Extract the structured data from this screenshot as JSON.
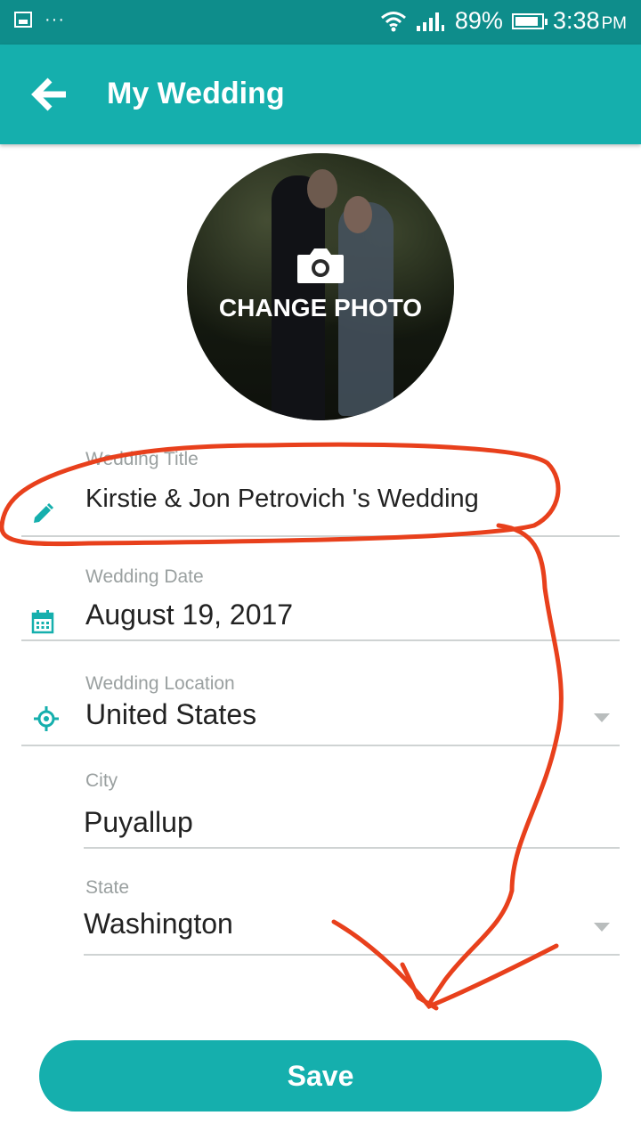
{
  "status_bar": {
    "dots": "···",
    "battery": "89%",
    "battery_level": 0.89,
    "time": "3:38",
    "time_suffix": "PM"
  },
  "app_bar": {
    "title": "My Wedding",
    "back_icon": "arrow-left-icon"
  },
  "photo": {
    "change_label": "CHANGE PHOTO",
    "icon": "camera-icon"
  },
  "form": {
    "title": {
      "label": "Wedding Title",
      "value": "Kirstie & Jon Petrovich 's Wedding",
      "icon": "pencil-icon"
    },
    "date": {
      "label": "Wedding Date",
      "value": "August 19, 2017",
      "icon": "calendar-icon"
    },
    "location": {
      "label": "Wedding Location",
      "value": "United States",
      "icon": "location-target-icon"
    },
    "city": {
      "label": "City",
      "value": "Puyallup"
    },
    "state": {
      "label": "State",
      "value": "Washington"
    }
  },
  "save_button": {
    "label": "Save"
  },
  "colors": {
    "status_bar": "#0e8d8b",
    "primary": "#15afad",
    "annotation": "#e8401c"
  }
}
